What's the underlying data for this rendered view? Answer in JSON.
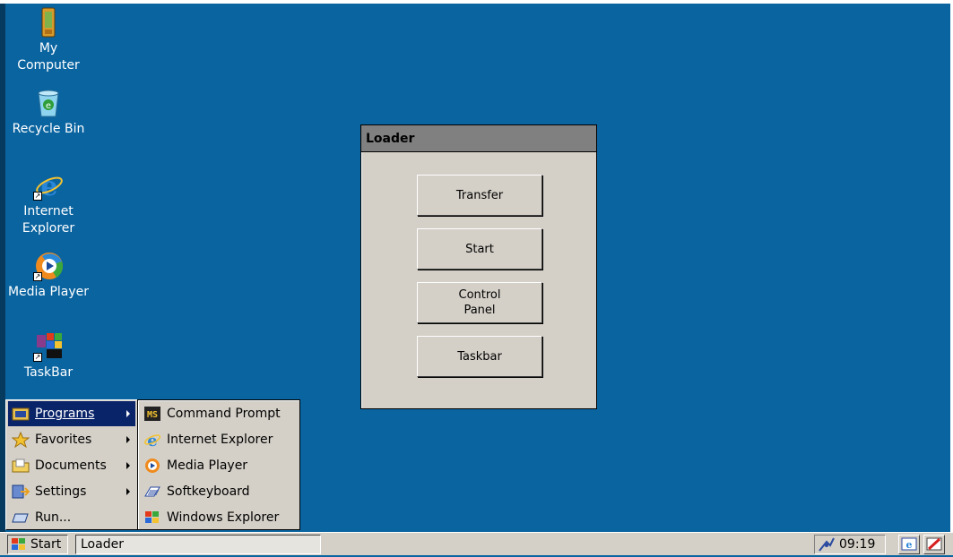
{
  "desktop": {
    "icons": [
      {
        "label": "My\nComputer",
        "icon": "my-computer-icon"
      },
      {
        "label": "Recycle Bin",
        "icon": "recycle-bin-icon"
      },
      {
        "label": "Internet\nExplorer",
        "icon": "internet-explorer-icon"
      },
      {
        "label": "Media Player",
        "icon": "media-player-icon"
      },
      {
        "label": "TaskBar",
        "icon": "taskbar-icon"
      }
    ]
  },
  "window": {
    "title": "Loader",
    "buttons": [
      "Transfer",
      "Start",
      "Control\nPanel",
      "Taskbar"
    ]
  },
  "start_menu": {
    "items": [
      {
        "label": "Programs",
        "icon": "programs-icon",
        "has_submenu": true,
        "selected": true
      },
      {
        "label": "Favorites",
        "icon": "favorites-icon",
        "has_submenu": true
      },
      {
        "label": "Documents",
        "icon": "documents-icon",
        "has_submenu": true
      },
      {
        "label": "Settings",
        "icon": "settings-icon",
        "has_submenu": true
      },
      {
        "label": "Run...",
        "icon": "run-icon",
        "has_submenu": false
      }
    ],
    "programs_submenu": [
      {
        "label": "Command Prompt",
        "icon": "command-prompt-icon"
      },
      {
        "label": "Internet Explorer",
        "icon": "internet-explorer-icon"
      },
      {
        "label": "Media Player",
        "icon": "media-player-icon"
      },
      {
        "label": "Softkeyboard",
        "icon": "softkeyboard-icon"
      },
      {
        "label": "Windows Explorer",
        "icon": "windows-explorer-icon"
      }
    ]
  },
  "taskbar": {
    "start_label": "Start",
    "task_label": "Loader",
    "clock": "09:19"
  },
  "colors": {
    "desktop": "#0a64a0",
    "face": "#d4d0c8",
    "selection": "#0a246a",
    "titlebar": "#808080"
  }
}
